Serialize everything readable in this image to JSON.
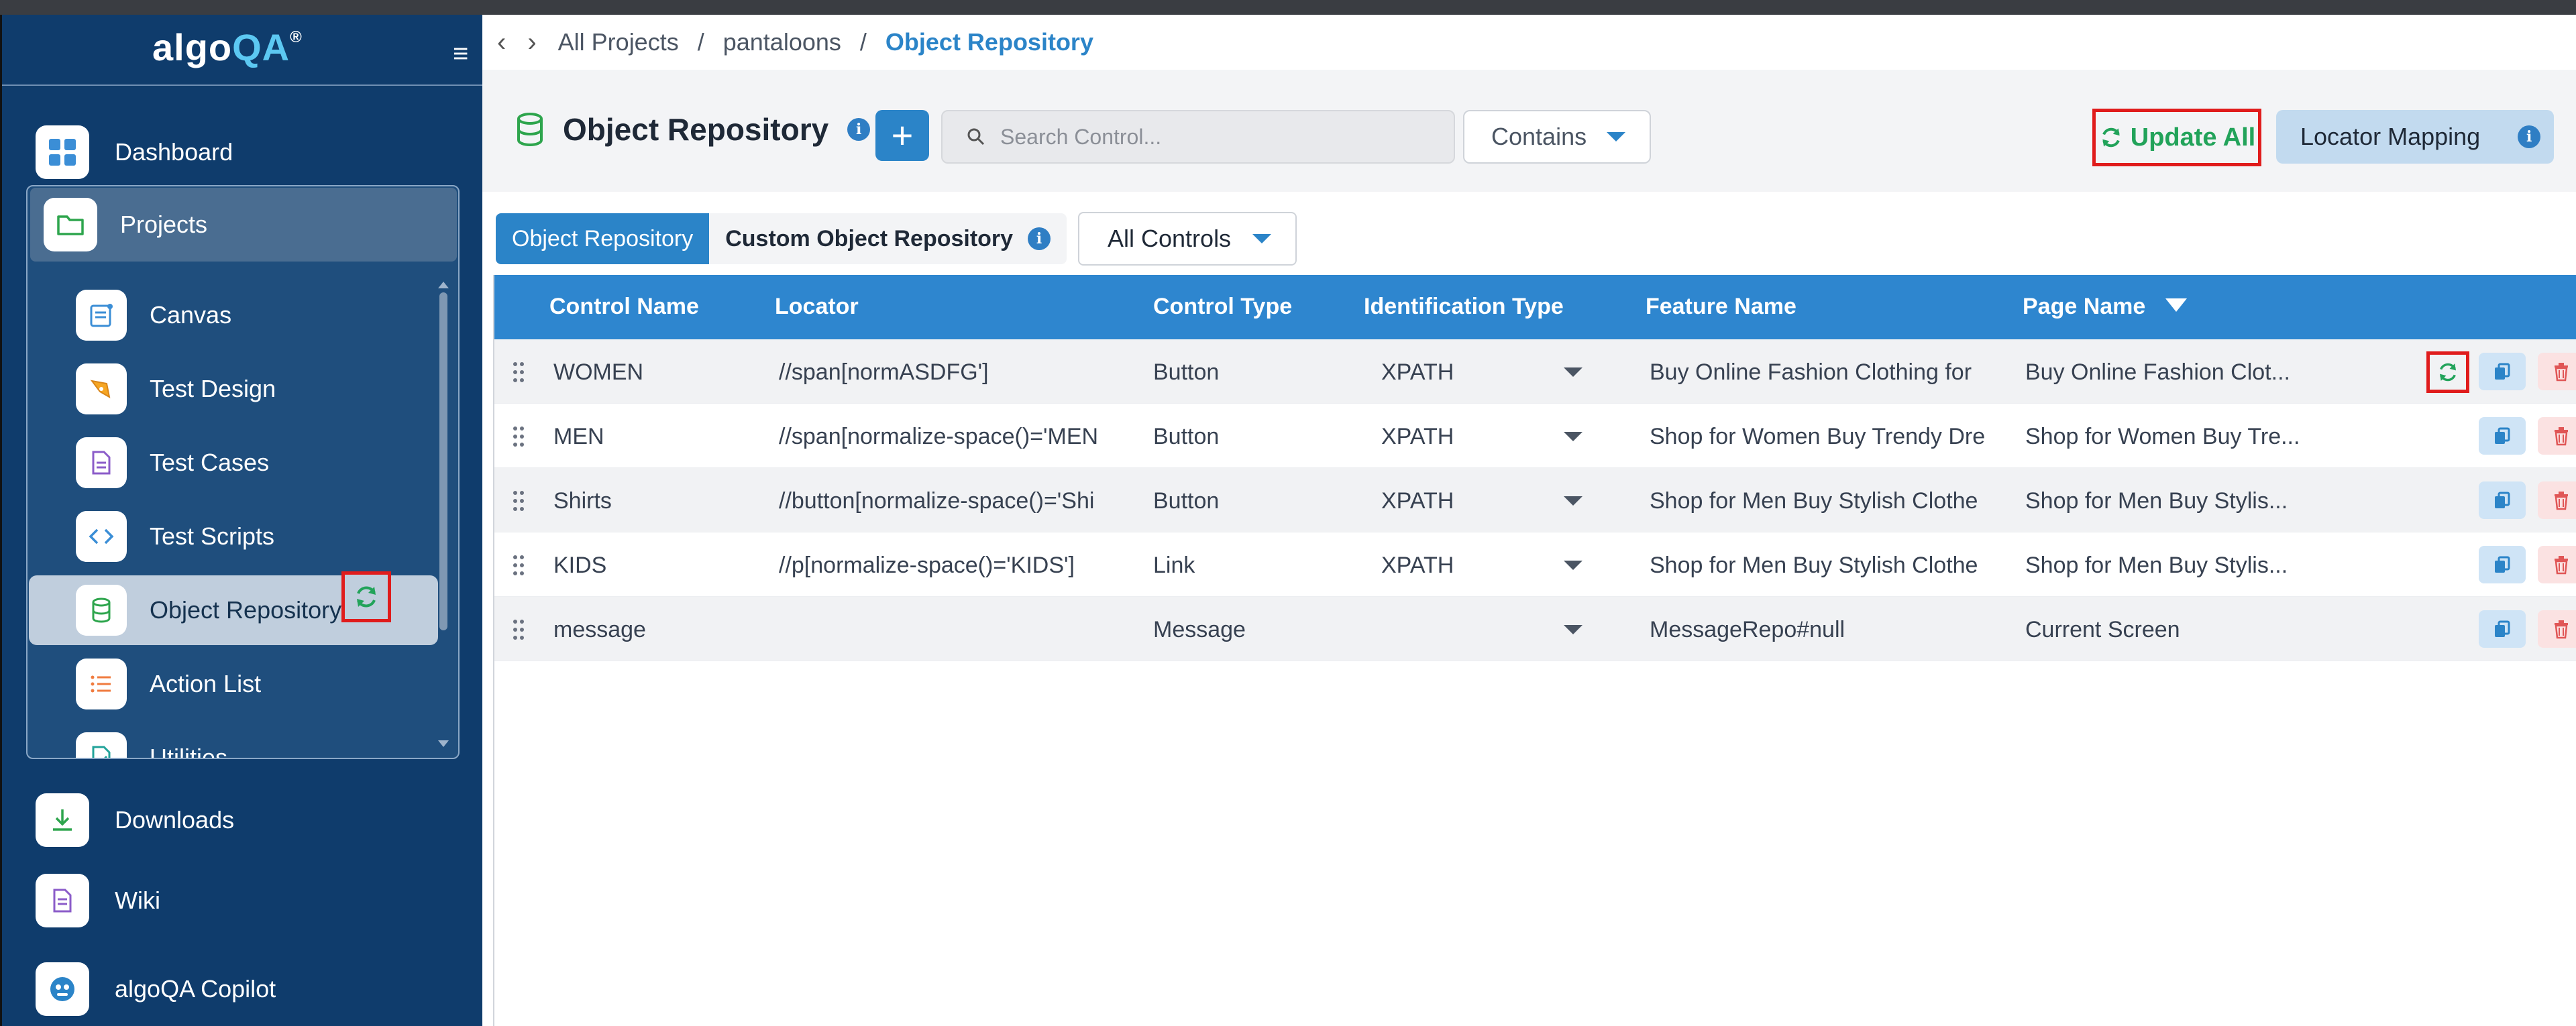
{
  "app": {
    "logo_main": "algo",
    "logo_accent": "QA",
    "logo_mark": "®"
  },
  "sidebar": {
    "top_items": [
      {
        "label": "Dashboard",
        "icon": "grid-icon"
      }
    ],
    "projects": {
      "label": "Projects",
      "icon": "folder-icon",
      "items": [
        {
          "label": "Canvas",
          "icon": "canvas-icon"
        },
        {
          "label": "Test Design",
          "icon": "pen-tool-icon"
        },
        {
          "label": "Test Cases",
          "icon": "document-icon"
        },
        {
          "label": "Test Scripts",
          "icon": "code-icon"
        },
        {
          "label": "Object Repository",
          "icon": "database-icon"
        },
        {
          "label": "Action List",
          "icon": "list-icon"
        },
        {
          "label": "Utilities",
          "icon": "utilities-icon"
        }
      ]
    },
    "bottom_items": [
      {
        "label": "Downloads",
        "icon": "download-icon"
      },
      {
        "label": "Wiki",
        "icon": "wiki-icon"
      },
      {
        "label": "algoQA Copilot",
        "icon": "copilot-icon"
      }
    ]
  },
  "breadcrumb": {
    "items": [
      "All Projects",
      "pantaloons"
    ],
    "current": "Object Repository",
    "separator": "/"
  },
  "header": {
    "title": "Object Repository",
    "search_placeholder": "Search Control...",
    "match_mode": "Contains",
    "update_all_label": "Update All",
    "locator_mapping_label": "Locator Mapping"
  },
  "tabs": {
    "active": "Object Repository",
    "inactive": "Custom Object Repository",
    "filter": "All Controls"
  },
  "table": {
    "columns": [
      "Control Name",
      "Locator",
      "Control Type",
      "Identification Type",
      "Feature Name",
      "Page Name"
    ],
    "rows": [
      {
        "control_name": "WOMEN",
        "locator": "//span[normASDFG']",
        "control_type": "Button",
        "identification_type": "XPATH",
        "feature_name": "Buy Online Fashion Clothing for",
        "page_name": "Buy Online Fashion Clot..."
      },
      {
        "control_name": "MEN",
        "locator": "//span[normalize-space()='MEN",
        "control_type": "Button",
        "identification_type": "XPATH",
        "feature_name": "Shop for Women Buy Trendy Dre",
        "page_name": "Shop for Women Buy Tre..."
      },
      {
        "control_name": "Shirts",
        "locator": "//button[normalize-space()='Shi",
        "control_type": "Button",
        "identification_type": "XPATH",
        "feature_name": "Shop for Men Buy Stylish Clothe",
        "page_name": "Shop for Men Buy Stylis..."
      },
      {
        "control_name": "KIDS",
        "locator": "//p[normalize-space()='KIDS']",
        "control_type": "Link",
        "identification_type": "XPATH",
        "feature_name": "Shop for Men Buy Stylish Clothe",
        "page_name": "Shop for Men Buy Stylis..."
      },
      {
        "control_name": "message",
        "locator": "",
        "control_type": "Message",
        "identification_type": "",
        "feature_name": "MessageRepo#null",
        "page_name": "Current Screen"
      }
    ]
  },
  "colors": {
    "sidebar_bg": "#0f3c6c",
    "accent_blue": "#2b84c8",
    "success_green": "#22a35a",
    "highlight_red": "#e01c1c",
    "danger_red": "#e05656"
  }
}
